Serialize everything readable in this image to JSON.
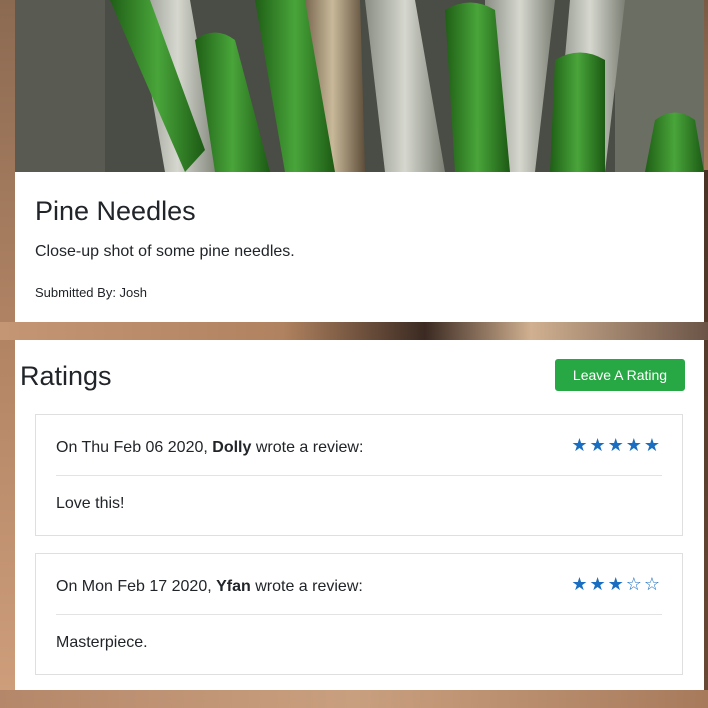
{
  "photo_card": {
    "title": "Pine Needles",
    "description": "Close-up shot of some pine needles.",
    "submitted_by": "Submitted By: Josh"
  },
  "ratings": {
    "heading": "Ratings",
    "leave_button_label": "Leave A Rating",
    "accent_color": "#28a745",
    "star_color": "#1a6ec2",
    "reviews": [
      {
        "prefix": "On Thu Feb 06 2020, ",
        "author": "Dolly",
        "suffix": " wrote a review:",
        "stars": "★★★★★",
        "rating": 5,
        "body": "Love this!"
      },
      {
        "prefix": "On Mon Feb 17 2020, ",
        "author": "Yfan",
        "suffix": " wrote a review:",
        "stars": "★★★☆☆",
        "rating": 3,
        "body": "Masterpiece."
      }
    ]
  }
}
